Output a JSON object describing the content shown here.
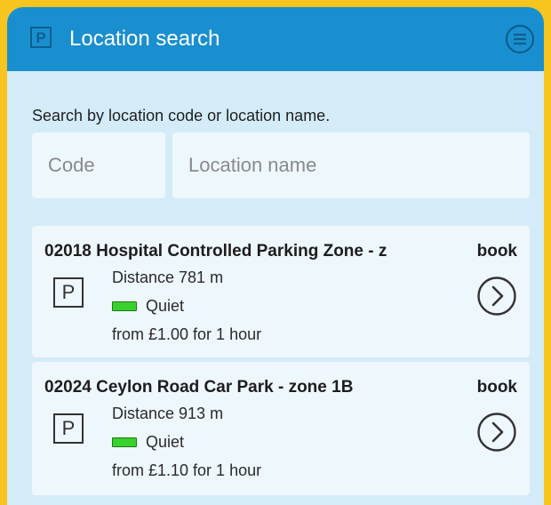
{
  "header": {
    "logo": "P",
    "title": "Location search",
    "menu_icon": "menu-icon"
  },
  "search": {
    "instruction": "Search by location code or location name.",
    "code_placeholder": "Code",
    "name_placeholder": "Location name"
  },
  "results": [
    {
      "code": "02018",
      "name": "Hospital Controlled Parking Zone - z",
      "book_label": "book",
      "icon": "P",
      "distance": "Distance 781 m",
      "status": "Quiet",
      "price": "from £1.00 for 1 hour"
    },
    {
      "code": "02024",
      "name": "Ceylon Road Car Park - zone 1B",
      "book_label": "book",
      "icon": "P",
      "distance": "Distance 913 m",
      "status": "Quiet",
      "price": "from £1.10 for 1 hour"
    }
  ],
  "colors": {
    "header_bg": "#1a8fd0",
    "page_bg": "#d3ecf8",
    "frame": "#f7c51d",
    "status_quiet": "#39d12b"
  }
}
